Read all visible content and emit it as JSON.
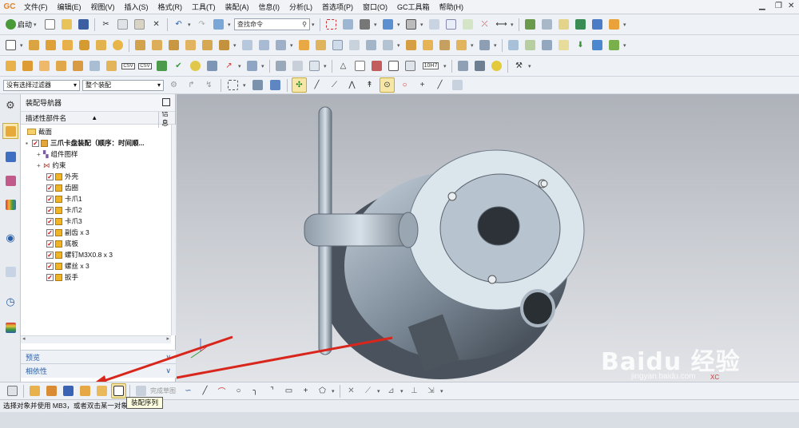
{
  "menu": {
    "logo": "GC",
    "items": [
      "文件(F)",
      "编辑(E)",
      "视图(V)",
      "插入(S)",
      "格式(R)",
      "工具(T)",
      "装配(A)",
      "信息(I)",
      "分析(L)",
      "首选项(P)",
      "窗口(O)",
      "GC工具箱",
      "帮助(H)"
    ]
  },
  "toolbar1": {
    "start_label": "启动",
    "search_placeholder": "查找命令"
  },
  "toolbar3": {
    "csv1": "CSV",
    "csv2": "CSV",
    "dim_label": "10H7"
  },
  "filterbar": {
    "selection_filter": "没有选择过滤器",
    "scope": "整个装配"
  },
  "navigator": {
    "title": "装配导航器",
    "col_name": "描述性部件名",
    "col_info": "信息",
    "items": [
      {
        "label": "截面",
        "kind": "folder"
      },
      {
        "label": "三爪卡盘装配（顺序：时间顺...",
        "kind": "assembly"
      },
      {
        "label": "组件图样",
        "kind": "group"
      },
      {
        "label": "约束",
        "kind": "group"
      },
      {
        "label": "外壳",
        "kind": "part"
      },
      {
        "label": "齿圈",
        "kind": "part"
      },
      {
        "label": "卡爪1",
        "kind": "part"
      },
      {
        "label": "卡爪2",
        "kind": "part"
      },
      {
        "label": "卡爪3",
        "kind": "part"
      },
      {
        "label": "副齿 x 3",
        "kind": "part"
      },
      {
        "label": "底板",
        "kind": "part"
      },
      {
        "label": "螺钉M3X0.8 x 3",
        "kind": "part"
      },
      {
        "label": "螺丝 x 3",
        "kind": "part"
      },
      {
        "label": "扳手",
        "kind": "part"
      }
    ],
    "preview": "预览",
    "dependency": "相依性"
  },
  "viewport": {
    "triad_label": "XC"
  },
  "bottom": {
    "label": "完成草图"
  },
  "tooltip": "装配序列",
  "status": "选择对象并使用 MB3，或者双击某一对象",
  "watermark": {
    "line1": "Baidu 经验",
    "line2": "jingyan.baidu.com"
  },
  "colors": {
    "accent": "#2b5ea8",
    "arrow": "#d9261c",
    "part": "#f0b429"
  }
}
